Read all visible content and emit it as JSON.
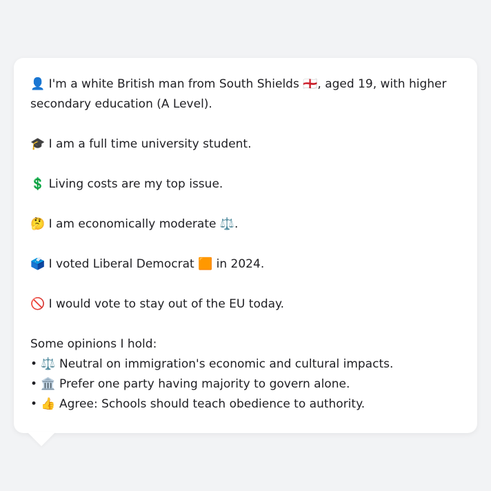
{
  "profile": {
    "intro": "👤 I'm a white British man from South Shields 🏴󠁧󠁢󠁥󠁮󠁧󠁿, aged 19, with higher secondary education (A Level).",
    "occupation": "🎓 I am a full time university student.",
    "top_issue": "💲 Living costs are my top issue.",
    "economics": "🤔 I am economically moderate ⚖️.",
    "vote_2024": "🗳️ I voted Liberal Democrat 🟧 in 2024.",
    "eu_vote": "🚫 I would vote to stay out of the EU today."
  },
  "opinions": {
    "title": "Some opinions I hold:",
    "items": [
      "• ⚖️ Neutral on immigration's economic and cultural impacts.",
      "• 🏛️ Prefer one party having majority to govern alone.",
      "• 👍 Agree: Schools should teach obedience to authority."
    ]
  },
  "colors": {
    "background": "#f2f3f5",
    "bubble": "#ffffff",
    "text": "#1f1f23"
  }
}
